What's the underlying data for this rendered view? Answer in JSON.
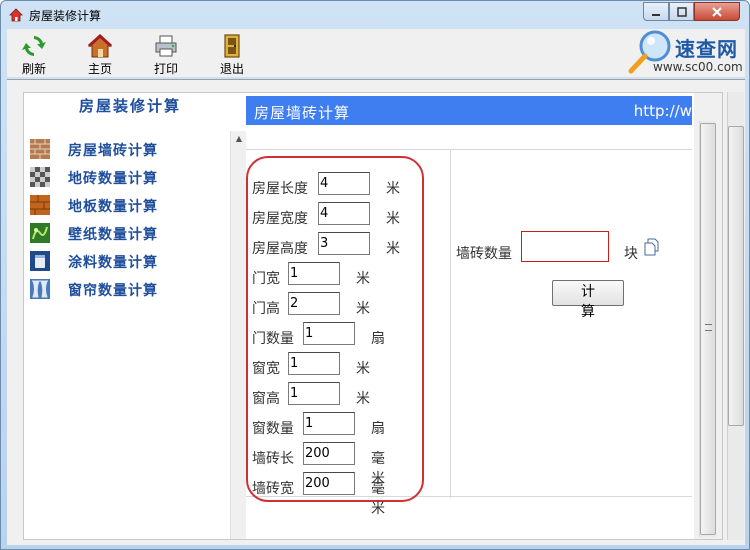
{
  "window": {
    "title": "房屋装修计算"
  },
  "toolbar": {
    "items": [
      {
        "label": "刷新",
        "icon": "refresh-icon"
      },
      {
        "label": "主页",
        "icon": "home-icon"
      },
      {
        "label": "打印",
        "icon": "printer-icon"
      },
      {
        "label": "退出",
        "icon": "exit-icon"
      }
    ],
    "brand": {
      "title": "速查网",
      "url": "www.sc00.com"
    }
  },
  "nav": {
    "title": "房屋装修计算",
    "items": [
      {
        "label": "房屋墙砖计算",
        "icon": "wall-tile-icon"
      },
      {
        "label": "地砖数量计算",
        "icon": "floor-tile-icon"
      },
      {
        "label": "地板数量计算",
        "icon": "wood-floor-icon"
      },
      {
        "label": "壁纸数量计算",
        "icon": "wallpaper-icon"
      },
      {
        "label": "涂料数量计算",
        "icon": "paint-icon"
      },
      {
        "label": "窗帘数量计算",
        "icon": "curtain-icon"
      }
    ]
  },
  "content": {
    "header_title": "房屋墙砖计算",
    "header_url": "http://w",
    "fields": [
      {
        "label": "房屋长度",
        "value": "4",
        "unit": "米"
      },
      {
        "label": "房屋宽度",
        "value": "4",
        "unit": "米"
      },
      {
        "label": "房屋高度",
        "value": "3",
        "unit": "米"
      },
      {
        "label": "门宽",
        "value": "1",
        "unit": "米"
      },
      {
        "label": "门高",
        "value": "2",
        "unit": "米"
      },
      {
        "label": "门数量",
        "value": "1",
        "unit": "扇"
      },
      {
        "label": "窗宽",
        "value": "1",
        "unit": "米"
      },
      {
        "label": "窗高",
        "value": "1",
        "unit": "米"
      },
      {
        "label": "窗数量",
        "value": "1",
        "unit": "扇"
      },
      {
        "label": "墙砖长",
        "value": "200",
        "unit": "毫米"
      },
      {
        "label": "墙砖宽",
        "value": "200",
        "unit": "毫米"
      }
    ],
    "result": {
      "label": "墙砖数量",
      "value": "",
      "unit": "块"
    },
    "calc_button": "计 算"
  }
}
